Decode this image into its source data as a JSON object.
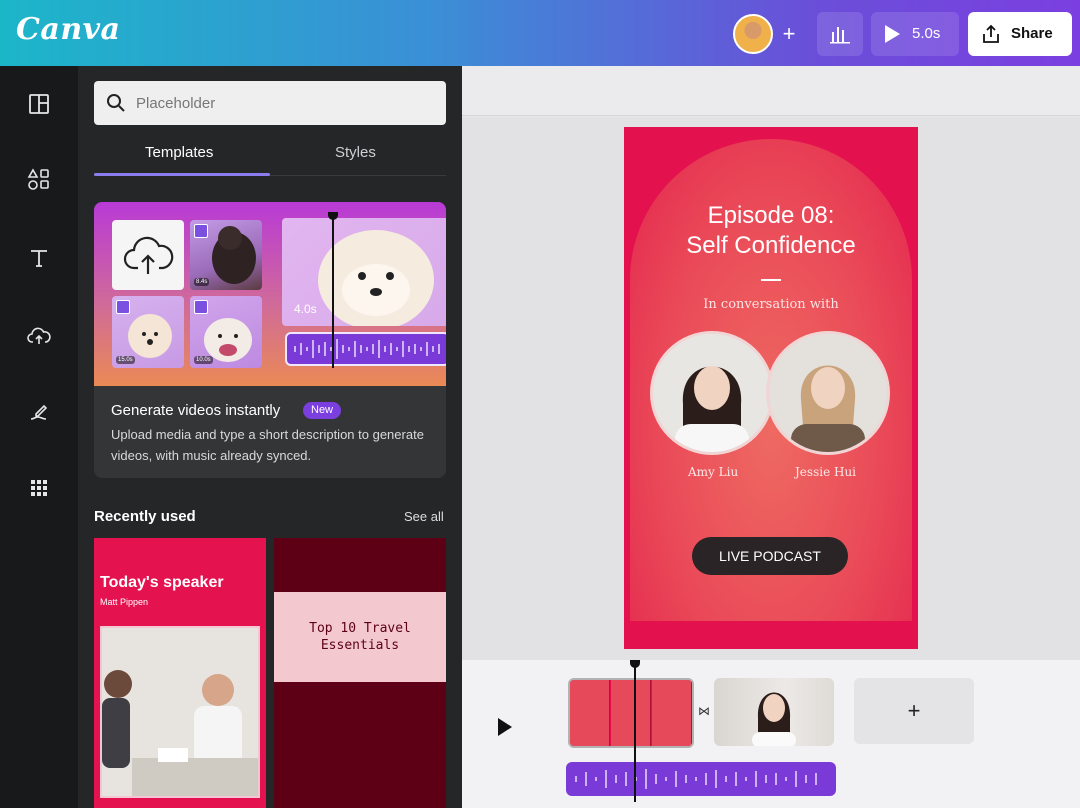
{
  "header": {
    "logo": "Canva",
    "play_duration": "5.0s",
    "share_label": "Share"
  },
  "rail": {
    "items": [
      "design",
      "elements",
      "text",
      "uploads",
      "draw",
      "apps"
    ]
  },
  "panel": {
    "search": {
      "placeholder": "Placeholder",
      "value": ""
    },
    "tabs": [
      {
        "label": "Templates",
        "active": true
      },
      {
        "label": "Styles",
        "active": false
      }
    ],
    "promo": {
      "title": "Generate videos instantly",
      "badge": "New",
      "description": "Upload media and type a short description to generate videos, with music already synced.",
      "tile_durations": [
        "8.4s",
        "15.0s",
        "10.0s"
      ],
      "clip_duration": "4.0s"
    },
    "recent": {
      "title": "Recently used",
      "see_all": "See all",
      "cards": [
        {
          "title": "Today's speaker",
          "subtitle": "Matt Pippen"
        },
        {
          "title": "Top 10 Travel Essentials"
        }
      ]
    }
  },
  "design": {
    "episode": "Episode 08:",
    "topic": "Self Confidence",
    "intro": "In conversation with",
    "guest_left": "Amy Liu",
    "guest_right": "Jessie Hui",
    "cta": "LIVE PODCAST",
    "colors": {
      "primary": "#e3124f",
      "arch": "#ea4a58",
      "pill": "#2a2426"
    }
  },
  "timeline": {
    "add_label": "+"
  },
  "colors": {
    "accent": "#7b3fe0",
    "header_start": "#1cb6c9",
    "header_end": "#7b3fe0"
  }
}
